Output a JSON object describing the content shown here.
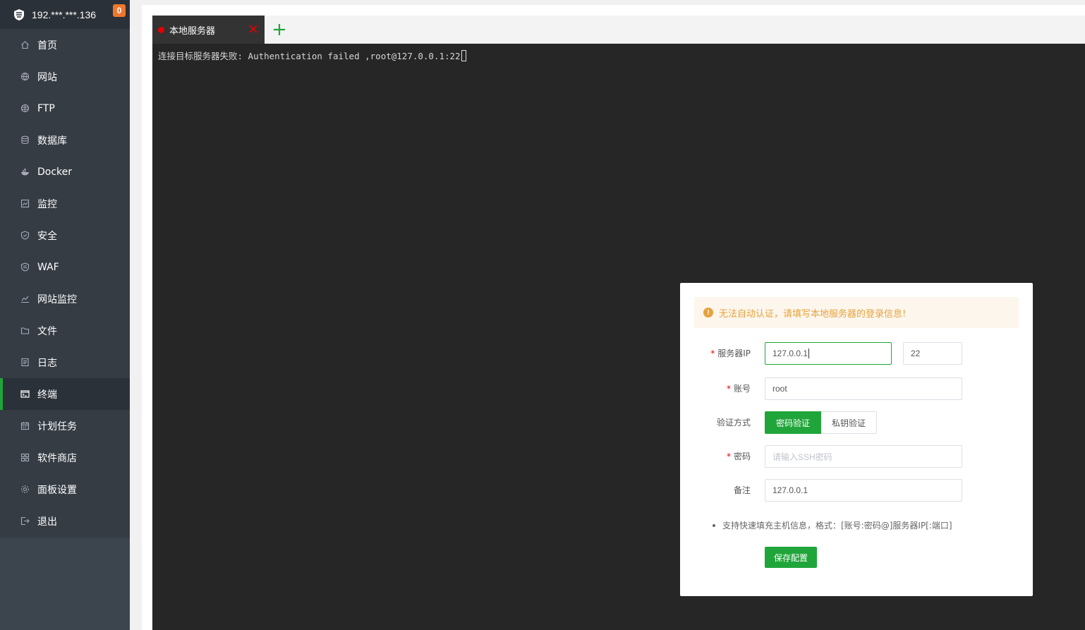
{
  "sidebar": {
    "server_ip": "192.***.***.136",
    "notification_count": "0",
    "items": [
      {
        "label": "首页",
        "icon": "home-icon"
      },
      {
        "label": "网站",
        "icon": "globe-icon"
      },
      {
        "label": "FTP",
        "icon": "ftp-globe-icon"
      },
      {
        "label": "数据库",
        "icon": "database-icon"
      },
      {
        "label": "Docker",
        "icon": "docker-icon"
      },
      {
        "label": "监控",
        "icon": "monitor-chart-icon"
      },
      {
        "label": "安全",
        "icon": "shield-icon"
      },
      {
        "label": "WAF",
        "icon": "waf-shield-icon"
      },
      {
        "label": "网站监控",
        "icon": "site-monitor-icon"
      },
      {
        "label": "文件",
        "icon": "folder-icon"
      },
      {
        "label": "日志",
        "icon": "log-icon"
      },
      {
        "label": "终端",
        "icon": "terminal-icon",
        "active": true
      },
      {
        "label": "计划任务",
        "icon": "calendar-icon"
      },
      {
        "label": "软件商店",
        "icon": "apps-grid-icon"
      },
      {
        "label": "面板设置",
        "icon": "gear-icon"
      },
      {
        "label": "退出",
        "icon": "logout-icon"
      }
    ],
    "active_color": "#20a53a"
  },
  "tabs": {
    "active_tab_label": "本地服务器",
    "status_color": "#e60000"
  },
  "terminal": {
    "output_line": "连接目标服务器失败: Authentication failed ,root@127.0.0.1:22"
  },
  "dialog": {
    "alert_text": "无法自动认证，请填写本地服务器的登录信息!",
    "server_ip_label": "服务器IP",
    "server_ip_value": "127.0.0.1",
    "port_value": "22",
    "account_label": "账号",
    "account_value": "root",
    "auth_method_label": "验证方式",
    "auth_password_option": "密码验证",
    "auth_key_option": "私钥验证",
    "password_label": "密码",
    "password_placeholder": "请输入SSH密码",
    "remark_label": "备注",
    "remark_value": "127.0.0.1",
    "tip_text": "支持快速填充主机信息，格式：[账号:密码@]服务器IP[:端口]",
    "save_button": "保存配置"
  }
}
